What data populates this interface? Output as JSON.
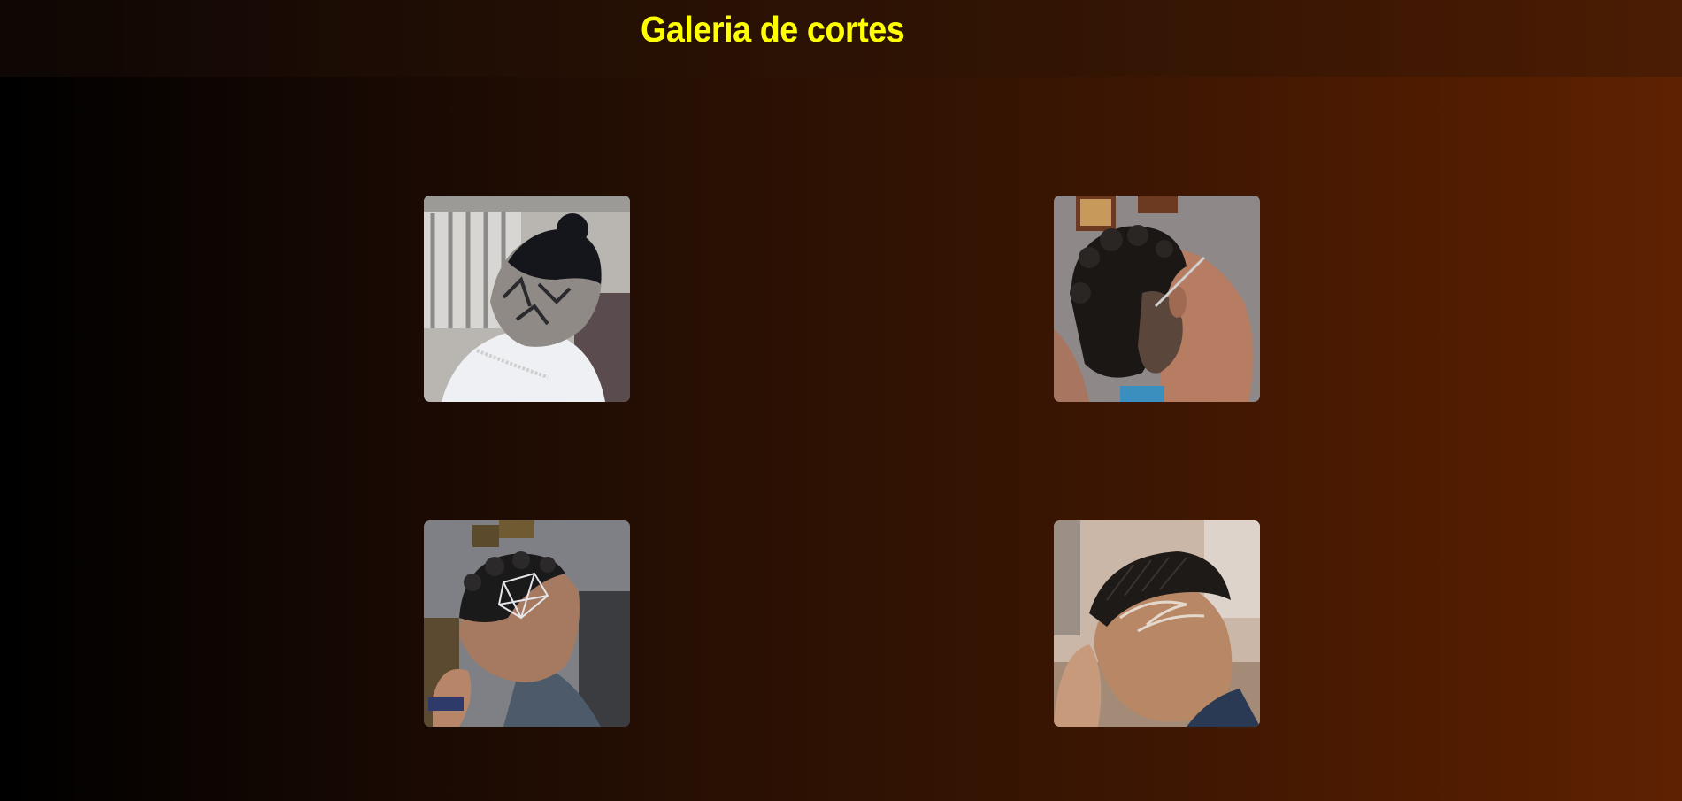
{
  "header": {
    "title": "Galeria de cortes",
    "title_color": "#ffff00"
  },
  "gallery": {
    "items": [
      {
        "subject": "man-bun-undercut-nape-design-photo"
      },
      {
        "subject": "curly-hair-fade-side-profile-photo"
      },
      {
        "subject": "curly-fade-geometric-hair-design-photo"
      },
      {
        "subject": "comb-over-fade-freestyle-design-photo"
      }
    ]
  }
}
